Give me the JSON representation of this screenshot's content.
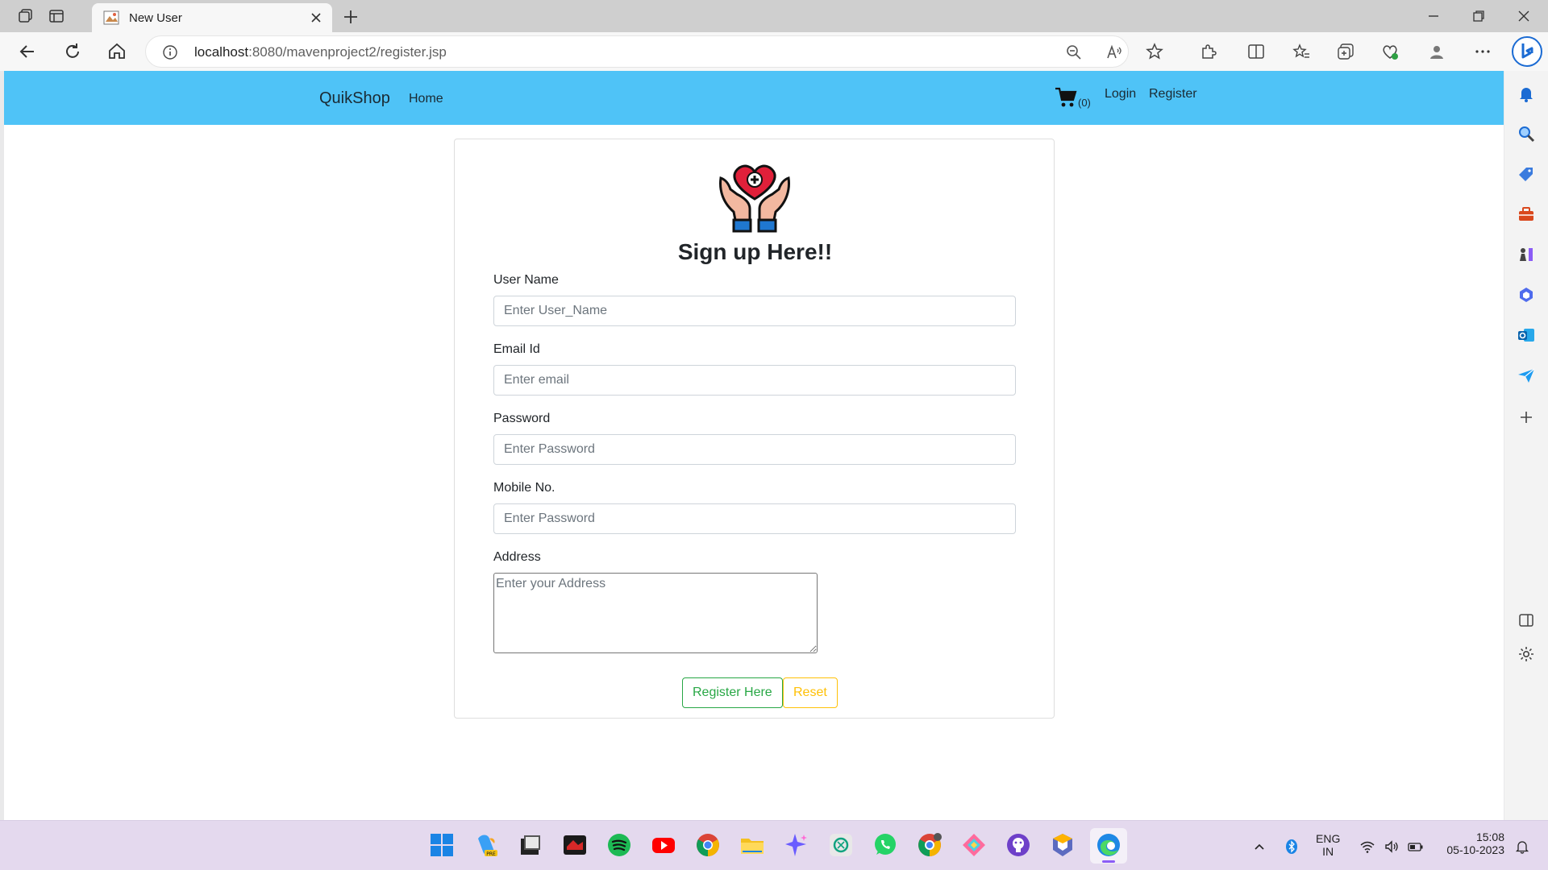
{
  "browser": {
    "tab_title": "New User",
    "url_host": "localhost",
    "url_path": ":8080/mavenproject2/register.jsp"
  },
  "site": {
    "brand": "QuikShop",
    "nav_home": "Home",
    "cart_count": "(0)",
    "nav_login": "Login",
    "nav_register": "Register"
  },
  "form": {
    "heading": "Sign up Here!!",
    "username_label": "User Name",
    "username_placeholder": "Enter User_Name",
    "email_label": "Email Id",
    "email_placeholder": "Enter email",
    "password_label": "Password",
    "password_placeholder": "Enter Password",
    "mobile_label": "Mobile No.",
    "mobile_placeholder": "Enter Password",
    "address_label": "Address",
    "address_placeholder": "Enter your Address",
    "register_button": "Register Here",
    "reset_button": "Reset"
  },
  "taskbar": {
    "lang_line1": "ENG",
    "lang_line2": "IN",
    "time": "15:08",
    "date": "05-10-2023"
  },
  "colors": {
    "site_nav": "#4fc3f7",
    "success": "#28a745",
    "warning": "#ffc107"
  }
}
